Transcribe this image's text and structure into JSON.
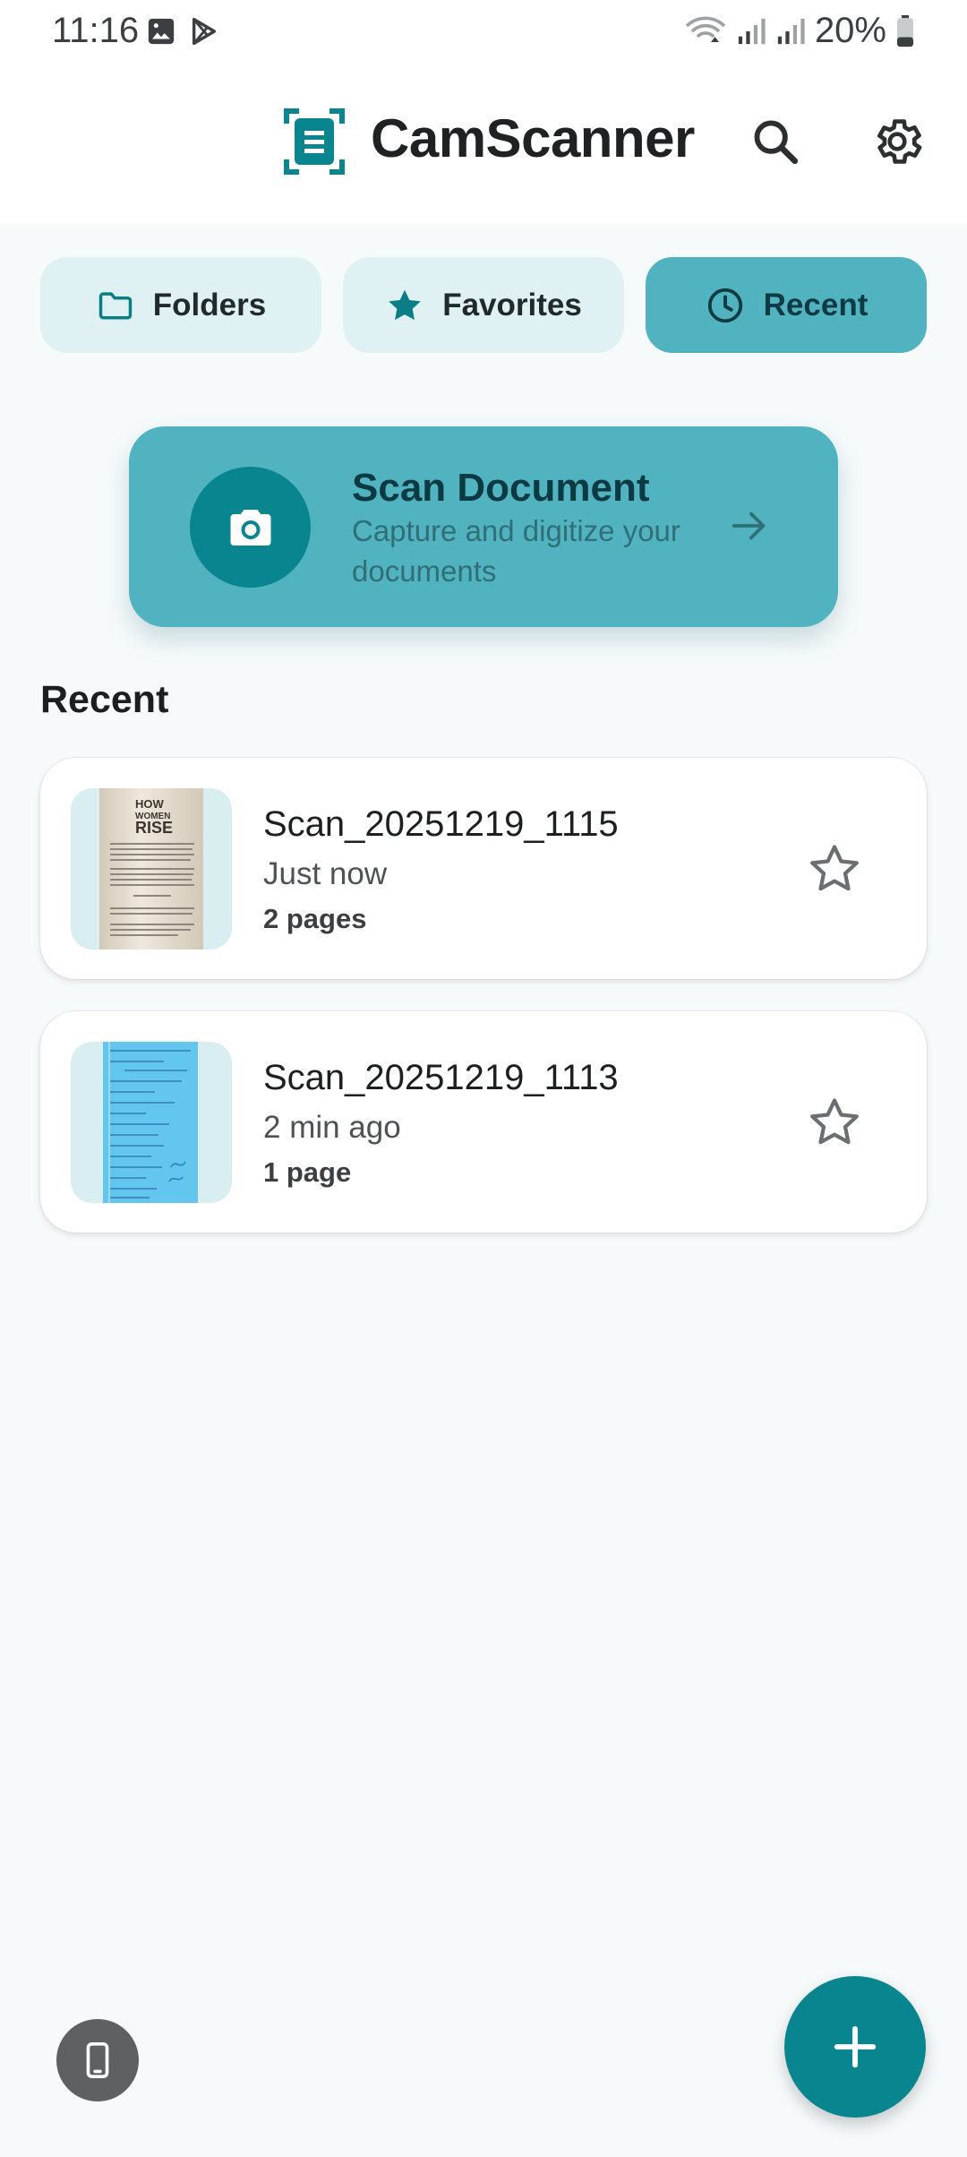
{
  "status_bar": {
    "time": "11:16",
    "battery": "20%",
    "icons": [
      "gallery-icon",
      "play-store-icon",
      "wifi-icon",
      "signal-icon",
      "signal-icon",
      "battery-icon"
    ]
  },
  "app_bar": {
    "title": "CamScanner",
    "logo_icon": "document-scan-logo-icon",
    "actions": [
      "search-icon",
      "gear-icon"
    ]
  },
  "tabs": [
    {
      "label": "Folders",
      "icon": "folder-icon",
      "active": false
    },
    {
      "label": "Favorites",
      "icon": "star-icon",
      "active": false
    },
    {
      "label": "Recent",
      "icon": "clock-icon",
      "active": true
    }
  ],
  "scan_card": {
    "title": "Scan Document",
    "subtitle": "Capture and digitize your documents",
    "icon": "camera-icon"
  },
  "recent": {
    "heading": "Recent",
    "items": [
      {
        "name": "Scan_20251219_1115",
        "time": "Just now",
        "pages": "2 pages",
        "favorite": false
      },
      {
        "name": "Scan_20251219_1113",
        "time": "2 min ago",
        "pages": "1 page",
        "favorite": false
      }
    ]
  },
  "colors": {
    "accent": "#08858e",
    "accent_light": "#52b3c0",
    "tab_bg": "#dff1f2",
    "background": "#f6fafb"
  }
}
